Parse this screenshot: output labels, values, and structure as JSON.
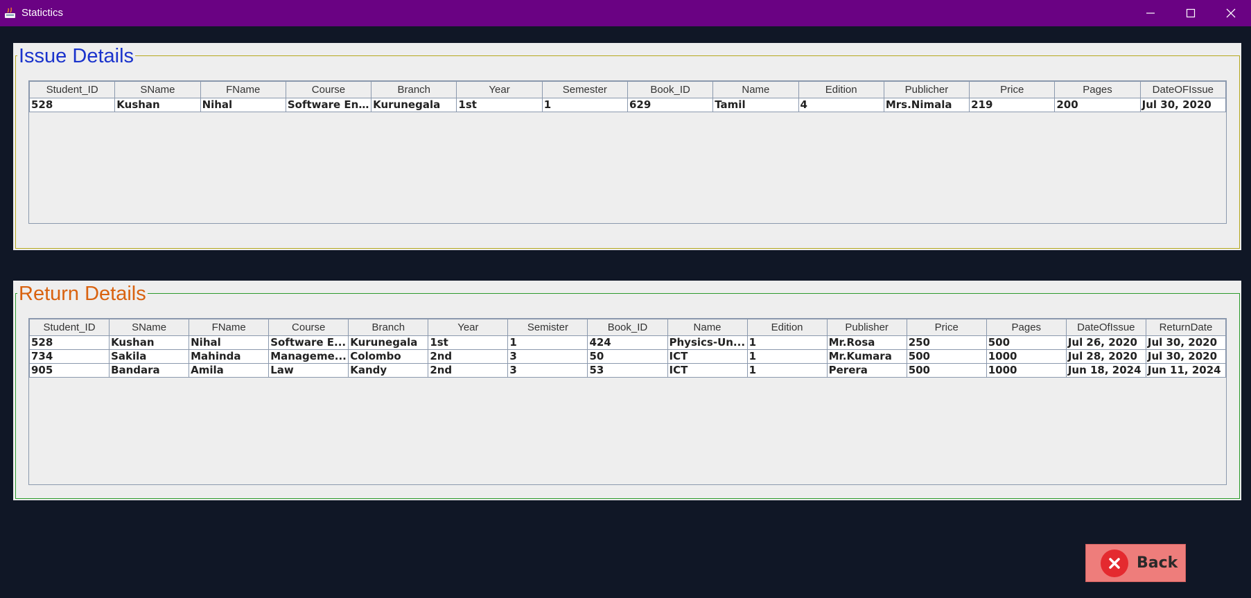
{
  "window": {
    "title": "Statictics",
    "minimize_icon": "minimize-icon",
    "maximize_icon": "maximize-icon",
    "close_icon": "close-icon",
    "titlebar_color": "#6a0283"
  },
  "issue": {
    "legend": "Issue Details",
    "legend_color": "#1a33cc",
    "border_color": "#b5a81c",
    "headers": [
      "Student_ID",
      "SName",
      "FName",
      "Course",
      "Branch",
      "Year",
      "Semester",
      "Book_ID",
      "Name",
      "Edition",
      "Publicher",
      "Price",
      "Pages",
      "DateOFIssue"
    ],
    "rows": [
      [
        "528",
        "Kushan",
        "Nihal",
        "Software En...",
        "Kurunegala",
        "1st",
        "1",
        "629",
        "Tamil",
        "4",
        "Mrs.Nimala",
        "219",
        "200",
        "Jul 30, 2020"
      ]
    ]
  },
  "return": {
    "legend": "Return Details",
    "legend_color": "#d9620f",
    "border_color": "#2a9a2a",
    "headers": [
      "Student_ID",
      "SName",
      "FName",
      "Course",
      "Branch",
      "Year",
      "Semister",
      "Book_ID",
      "Name",
      "Edition",
      "Publisher",
      "Price",
      "Pages",
      "DateOfIssue",
      "ReturnDate"
    ],
    "rows": [
      [
        "528",
        "Kushan",
        "Nihal",
        "Software E...",
        "Kurunegala",
        "1st",
        "1",
        "424",
        "Physics-Un...",
        "1",
        "Mr.Rosa",
        "250",
        "500",
        "Jul 26, 2020",
        "Jul 30, 2020"
      ],
      [
        "734",
        "Sakila",
        "Mahinda",
        "Manageme...",
        "Colombo",
        "2nd",
        "3",
        "50",
        "ICT",
        "1",
        "Mr.Kumara",
        "500",
        "1000",
        "Jul 28, 2020",
        "Jul 30, 2020"
      ],
      [
        "905",
        "Bandara",
        "Amila",
        "Law",
        "Kandy",
        "2nd",
        "3",
        "53",
        "ICT",
        "1",
        "Perera",
        "500",
        "1000",
        "Jun 18, 2024",
        "Jun 11, 2024"
      ]
    ]
  },
  "back_button": {
    "label": "Back",
    "icon": "close-circle-icon",
    "color": "#ee7d7b"
  }
}
